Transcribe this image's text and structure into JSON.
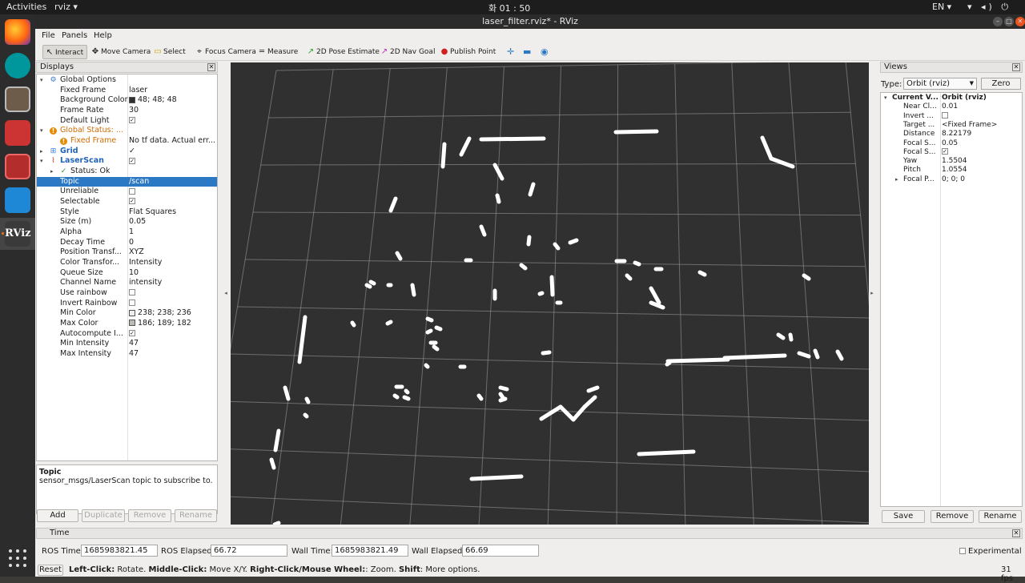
{
  "system": {
    "activities": "Activities",
    "app_menu": "rviz ▾",
    "clock": "화 01 : 50",
    "lang": "EN ▾",
    "tray": "▾ ◂) ⏻ ▾"
  },
  "window": {
    "title": "laser_filter.rviz* - RViz"
  },
  "menu": [
    "File",
    "Panels",
    "Help"
  ],
  "toolbar": {
    "interact": "Interact",
    "move_camera": "Move Camera",
    "select": "Select",
    "focus_camera": "Focus Camera",
    "measure": "Measure",
    "pose_estimate": "2D Pose Estimate",
    "nav_goal": "2D Nav Goal",
    "publish_point": "Publish Point"
  },
  "displays": {
    "title": "Displays",
    "rows": [
      {
        "k": "Global Options",
        "v": ""
      },
      {
        "k": "Fixed Frame",
        "v": "laser"
      },
      {
        "k": "Background Color",
        "v": "48; 48; 48"
      },
      {
        "k": "Frame Rate",
        "v": "30"
      },
      {
        "k": "Default Light",
        "v": "✓"
      },
      {
        "k": "Global Status: ...",
        "v": ""
      },
      {
        "k": "Fixed Frame",
        "v": "No tf data.  Actual err..."
      },
      {
        "k": "Grid",
        "v": "✓"
      },
      {
        "k": "LaserScan",
        "v": "✓"
      },
      {
        "k": "Status: Ok",
        "v": ""
      },
      {
        "k": "Topic",
        "v": "/scan"
      },
      {
        "k": "Unreliable",
        "v": ""
      },
      {
        "k": "Selectable",
        "v": "✓"
      },
      {
        "k": "Style",
        "v": "Flat Squares"
      },
      {
        "k": "Size (m)",
        "v": "0.05"
      },
      {
        "k": "Alpha",
        "v": "1"
      },
      {
        "k": "Decay Time",
        "v": "0"
      },
      {
        "k": "Position Transf...",
        "v": "XYZ"
      },
      {
        "k": "Color Transfor...",
        "v": "Intensity"
      },
      {
        "k": "Queue Size",
        "v": "10"
      },
      {
        "k": "Channel Name",
        "v": "intensity"
      },
      {
        "k": "Use rainbow",
        "v": ""
      },
      {
        "k": "Invert Rainbow",
        "v": ""
      },
      {
        "k": "Min Color",
        "v": "238; 238; 236"
      },
      {
        "k": "Max Color",
        "v": "186; 189; 182"
      },
      {
        "k": "Autocompute I...",
        "v": "✓"
      },
      {
        "k": "Min Intensity",
        "v": "47"
      },
      {
        "k": "Max Intensity",
        "v": "47"
      }
    ],
    "desc_title": "Topic",
    "desc_text": "sensor_msgs/LaserScan topic to subscribe to.",
    "btn_add": "Add",
    "btn_duplicate": "Duplicate",
    "btn_remove": "Remove",
    "btn_rename": "Rename"
  },
  "views": {
    "title": "Views",
    "type_label": "Type:",
    "type_value": "Orbit (rviz)",
    "zero": "Zero",
    "rows": [
      {
        "k": "Current V...",
        "v": "Orbit (rviz)"
      },
      {
        "k": "Near Cl...",
        "v": "0.01"
      },
      {
        "k": "Invert ...",
        "v": ""
      },
      {
        "k": "Target ...",
        "v": "<Fixed Frame>"
      },
      {
        "k": "Distance",
        "v": "8.22179"
      },
      {
        "k": "Focal S...",
        "v": "0.05"
      },
      {
        "k": "Focal S...",
        "v": "✓"
      },
      {
        "k": "Yaw",
        "v": "1.5504"
      },
      {
        "k": "Pitch",
        "v": "1.0554"
      },
      {
        "k": "Focal P...",
        "v": "0; 0; 0"
      }
    ],
    "save": "Save",
    "remove": "Remove",
    "rename": "Rename"
  },
  "time": {
    "title": "Time",
    "ros_time_label": "ROS Time:",
    "ros_time": "1685983821.45",
    "ros_elapsed_label": "ROS Elapsed:",
    "ros_elapsed": "66.72",
    "wall_time_label": "Wall Time:",
    "wall_time": "1685983821.49",
    "wall_elapsed_label": "Wall Elapsed:",
    "wall_elapsed": "66.69",
    "experimental": "Experimental",
    "reset": "Reset",
    "hint_1": "Left-Click:",
    "hint_1v": " Rotate. ",
    "hint_2": "Middle-Click:",
    "hint_2v": " Move X/Y. ",
    "hint_3": "Right-Click/Mouse Wheel:",
    "hint_3v": ": Zoom. ",
    "hint_4": "Shift",
    "hint_4v": ": More options.",
    "fps": "31 fps"
  },
  "colors": {
    "background": "#303030",
    "grid": "#a0a0a4",
    "scan": "#ffffff",
    "selection": "#2b78c5"
  }
}
